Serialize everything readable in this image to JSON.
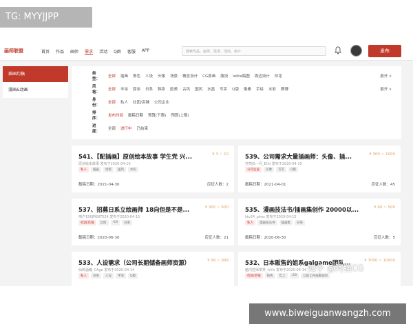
{
  "watermarks": {
    "top": "TG: MYYJJPP",
    "bottom": "www.biweiguanwangzh.com",
    "zhihu": "知乎 @阿强CG"
  },
  "topnav": {
    "logo": "画师联盟",
    "links": [
      "首页",
      "作品",
      "画师",
      "需求",
      "活动",
      "Q群",
      "客服",
      "APP"
    ],
    "active_index": 3,
    "search_placeholder": "搜索作品、画师、需求、活动、用户",
    "publish_label": "发布"
  },
  "sidebar": {
    "items": [
      "插画约稿",
      "漫画&动画"
    ],
    "active_index": 0
  },
  "filters": {
    "expand_label": "展开 ∨",
    "rows": [
      {
        "label": "类型：",
        "options": [
          "全部",
          "插画",
          "角色",
          "人设",
          "头像",
          "场景",
          "概念设计",
          "CG原画",
          "服设",
          "lolita稿图",
          "周边设计",
          "印花"
        ],
        "selected": 0,
        "expand": true
      },
      {
        "label": "风格：",
        "options": [
          "全部",
          "半涂",
          "厚涂",
          "日系",
          "韩系",
          "欧美",
          "古风",
          "国风",
          "水墨",
          "写实",
          "Q版",
          "像素",
          "手绘",
          "水彩",
          "赛博"
        ],
        "selected": 0,
        "expand": true
      },
      {
        "label": "身份：",
        "options": [
          "全部",
          "私人",
          "社团/店铺",
          "公司企业"
        ],
        "selected": 0,
        "expand": false
      },
      {
        "label": "排序：",
        "options": [
          "发布时间",
          "截稿日期",
          "预算(下限)",
          "预算(上限)"
        ],
        "selected": 0,
        "expand": false
      },
      {
        "label": "进度：",
        "options": [
          "全部",
          "进行中",
          "已结束"
        ],
        "selected": 1,
        "expand": false
      }
    ]
  },
  "cards": [
    {
      "title": "541、【配插画】原创绘本故事 学生党 兴...",
      "price": "¥ 3 ~ 10",
      "meta": "原创绘本故事 发布于2020-04-16",
      "tags": [
        {
          "t": "私人",
          "red": true
        },
        {
          "t": "插画",
          "red": false
        },
        {
          "t": "场景",
          "red": false
        },
        {
          "t": "国风",
          "red": false
        },
        {
          "t": "水彩",
          "red": false
        }
      ],
      "deadline": "截稿日期：2021-04-30",
      "applicants": "应征人数：2"
    },
    {
      "title": "539、公司需求大量插画师：头像、插...",
      "price": "¥ 300 ~ 1000",
      "meta": "作司白一闪_Ethi 发布于2020-04-15",
      "tags": [
        {
          "t": "公司企业",
          "red": true
        },
        {
          "t": "头像",
          "red": false
        },
        {
          "t": "写实",
          "red": false
        },
        {
          "t": "Q版",
          "red": false
        }
      ],
      "deadline": "截稿日期：2021-04-01",
      "applicants": "应征人数：45"
    },
    {
      "title": "537、招募日系立绘画师 18向但是不是...",
      "price": "¥ 300 ~ 600",
      "meta": "用户156JP6N7524 发布于2020-04-15",
      "tags": [
        {
          "t": "社团/店铺",
          "red": true
        },
        {
          "t": "立绘",
          "red": false
        },
        {
          "t": "r18",
          "red": false
        },
        {
          "t": "日系",
          "red": false
        }
      ],
      "deadline": "截稿日期：2020-06-30",
      "applicants": "应征人数：21"
    },
    {
      "title": "535、漫画技法书/插画集创作 20000以...",
      "price": "¥ 60 ~ 500",
      "meta": "ktv24_plmc 发布于2020-04-15",
      "tags": [
        {
          "t": "私人",
          "red": true
        },
        {
          "t": "漫画技法书",
          "red": false
        },
        {
          "t": "插画集",
          "red": false
        },
        {
          "t": "日系",
          "red": false
        }
      ],
      "deadline": "截稿日期：2020-06-30",
      "applicants": "应征人数：5"
    },
    {
      "title": "533、人设需求（公司长期储备画师资源）",
      "price": "¥ 99 ~ 999",
      "meta": "仙岗酒曦_CAge 发布于2020-04-14",
      "tags": [
        {
          "t": "私人",
          "red": true
        },
        {
          "t": "日系",
          "red": false
        },
        {
          "t": "人设",
          "red": false
        },
        {
          "t": "半涂",
          "red": false
        },
        {
          "t": "Q版",
          "red": false
        }
      ],
      "deadline": "",
      "applicants": ""
    },
    {
      "title": "532、日本販售的姐系galgame团队...",
      "price": "¥ 7000 ~ 10000",
      "meta": "脑内控师草茶_tvYx 发布于2020-04-14",
      "tags": [
        {
          "t": "社团/店铺",
          "red": true
        },
        {
          "t": "角色",
          "red": false
        },
        {
          "t": "年上",
          "red": false
        },
        {
          "t": "r18",
          "red": false
        },
        {
          "t": "以前上升画家画风",
          "red": false
        }
      ],
      "deadline": "",
      "applicants": ""
    }
  ]
}
